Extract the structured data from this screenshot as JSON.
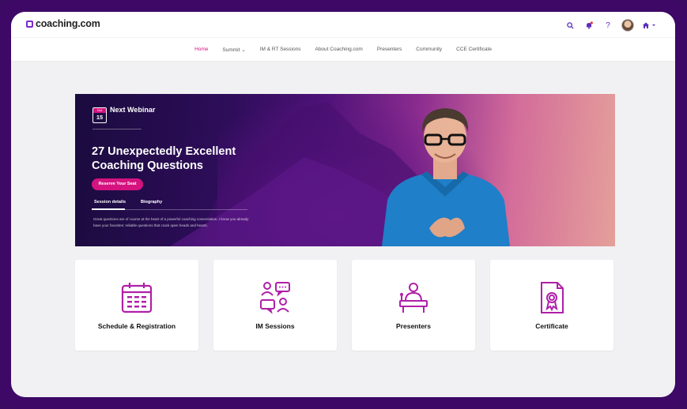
{
  "brand": {
    "name": "coaching.com",
    "accent": "#d4137f",
    "purple": "#7b2cc9",
    "frame": "#3e0866"
  },
  "nav": {
    "items": [
      {
        "label": "Home",
        "active": true
      },
      {
        "label": "Summit ⌄",
        "active": false
      },
      {
        "label": "IM & RT Sessions",
        "active": false
      },
      {
        "label": "About Coaching.com",
        "active": false
      },
      {
        "label": "Presenters",
        "active": false
      },
      {
        "label": "Community",
        "active": false
      },
      {
        "label": "CCE Certificate",
        "active": false
      }
    ]
  },
  "top_icons": {
    "search": "search-icon",
    "notifications": "bell-icon",
    "help": "?",
    "home": "home-icon"
  },
  "hero": {
    "date_month": "Oct",
    "date_day": "15",
    "next_label": "Next Webinar",
    "title": "27 Unexpectedly Excellent Coaching Questions",
    "reserve_label": "Reserve Your Seat",
    "tabs": [
      "Session details",
      "Biography"
    ],
    "description": "Great questions are of course at the heart of a powerful coaching conversation. I know you already have your favorites: reliable questions that crack open heads and hearts."
  },
  "cards": [
    {
      "label": "Schedule & Registration",
      "icon": "calendar-icon"
    },
    {
      "label": "IM Sessions",
      "icon": "chat-people-icon"
    },
    {
      "label": "Presenters",
      "icon": "presenter-icon"
    },
    {
      "label": "Certificate",
      "icon": "certificate-icon"
    }
  ]
}
